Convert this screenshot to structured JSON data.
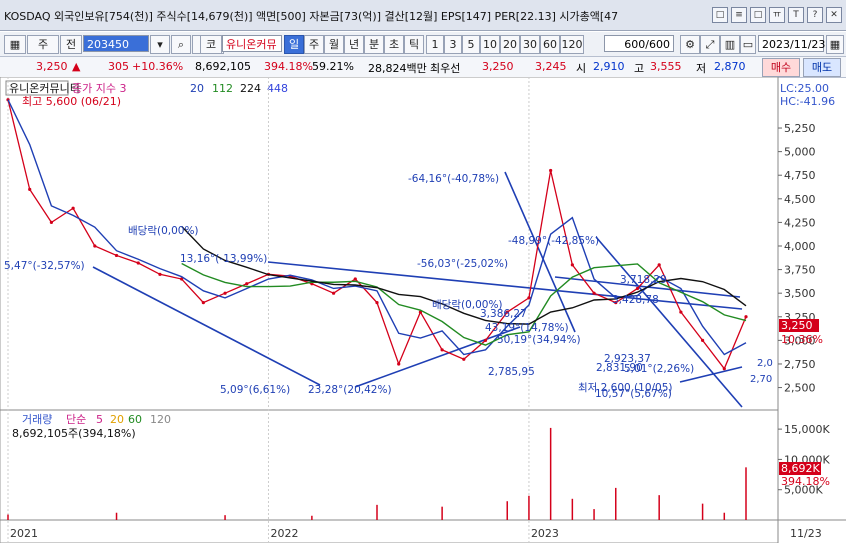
{
  "header": {
    "info": "KOSDAQ 외국인보유[754(천)] 주식수[14,679(천)] 액면[500] 자본금[73(억)] 결산[12월] EPS[147] PER[22.13] 시가총액[47",
    "icons": [
      "□",
      "≡",
      "□",
      "ㅠ",
      "T",
      "?"
    ]
  },
  "toolbar": {
    "type_select": "주",
    "prev_button": "전",
    "code": "203450",
    "kind_button": "코",
    "stock_name": "유니온커뮤",
    "periods": [
      "일",
      "주",
      "월",
      "년",
      "분",
      "초",
      "틱"
    ],
    "selected_period": "일",
    "intervals": [
      "1",
      "3",
      "5",
      "10",
      "20",
      "30",
      "60",
      "120"
    ],
    "range": "600/600",
    "date": "2023/11/23"
  },
  "quote": {
    "price": "3,250",
    "change": "305",
    "change_pct": "+10.36%",
    "volume": "8,692,105",
    "vol_ratio": "394.18%",
    "turnover": "59.21%",
    "amount": "28,824백만",
    "bid_label": "최우선",
    "bid1": "3,250",
    "bid2": "3,245",
    "open_label": "시",
    "open": "2,910",
    "high_label": "고",
    "high": "3,555",
    "low_label": "저",
    "low": "2,870",
    "buy_label": "매수",
    "sell_label": "매도"
  },
  "chart_data": {
    "type": "line",
    "title": "유니온커뮤니티",
    "legend": [
      "종가 지수 3",
      "20",
      "112",
      "224",
      "448"
    ],
    "series_colors": {
      "price": "#d4001a",
      "ma20": "#1f3fb4",
      "ma112": "#228b22",
      "ma224": "#111111",
      "ma448": "#3344dd"
    },
    "max_label": "최고 5,600 (06/21)",
    "min_label": "최저 2,600 (10/05)",
    "lc": "LC:25.00",
    "hc": "HC:-41.96",
    "price_labels": [
      "3,250",
      "10.36%"
    ],
    "right_labels": [
      "2,0",
      "2,70"
    ],
    "yaxis_ticks": [
      "5,250",
      "5,000",
      "4,750",
      "4,500",
      "4,250",
      "4,000",
      "3,750",
      "3,500",
      "3,250",
      "3,000",
      "2,750",
      "2,500"
    ],
    "ylim": [
      2400,
      5600
    ],
    "xaxis_ticks": [
      "2021",
      "2022",
      "2023",
      "11/23"
    ],
    "annotations": [
      "5,47°(-32,57%)",
      "배당락(0,00%)",
      "13,16°(-13,99%)",
      "-64,16°(-40,78%)",
      "-48,99°(-42,85%)",
      "-56,03°(-25,02%)",
      "3,718,29",
      "배당락(0,00%)",
      "3,386,27",
      "3,428,78",
      "43,19°(14,78%)",
      "50,19°(34,94%)",
      "2,923,37",
      "2,831,90",
      "5,01°(2,26%)",
      "2,785,95",
      "5,09°(6,61%)",
      "23,28°(20,42%)",
      "10,57°(5,67%)"
    ],
    "price": [
      [
        "2021-01",
        5550
      ],
      [
        "2021-02",
        4600
      ],
      [
        "2021-03",
        4250
      ],
      [
        "2021-04",
        4400
      ],
      [
        "2021-05",
        4000
      ],
      [
        "2021-06",
        3900
      ],
      [
        "2021-07",
        3820
      ],
      [
        "2021-08",
        3700
      ],
      [
        "2021-09",
        3650
      ],
      [
        "2021-10",
        3400
      ],
      [
        "2021-11",
        3500
      ],
      [
        "2021-12",
        3600
      ],
      [
        "2022-01",
        3700
      ],
      [
        "2022-02",
        3680
      ],
      [
        "2022-03",
        3600
      ],
      [
        "2022-04",
        3500
      ],
      [
        "2022-05",
        3650
      ],
      [
        "2022-06",
        3400
      ],
      [
        "2022-07",
        2750
      ],
      [
        "2022-08",
        3300
      ],
      [
        "2022-09",
        2900
      ],
      [
        "2022-10",
        2800
      ],
      [
        "2022-11",
        3000
      ],
      [
        "2022-12",
        3300
      ],
      [
        "2023-01",
        3450
      ],
      [
        "2023-02",
        4800
      ],
      [
        "2023-03",
        3800
      ],
      [
        "2023-04",
        3500
      ],
      [
        "2023-05",
        3400
      ],
      [
        "2023-06",
        3550
      ],
      [
        "2023-07",
        3800
      ],
      [
        "2023-08",
        3300
      ],
      [
        "2023-09",
        3000
      ],
      [
        "2023-10",
        2700
      ],
      [
        "2023-11",
        3250
      ]
    ],
    "volume_panel": {
      "legend": [
        "거래량",
        "단순",
        "5",
        "20",
        "60",
        "120"
      ],
      "latest": "8,692,105주(394,18%)",
      "ticks": [
        "15,000K",
        "10,000K",
        "5,000K"
      ],
      "ylim": [
        0,
        17000
      ],
      "last_value_label": "8,692K",
      "last_ratio_label": "394.18%",
      "spikes": [
        [
          "2021-01",
          900
        ],
        [
          "2021-06",
          1200
        ],
        [
          "2021-11",
          800
        ],
        [
          "2022-03",
          700
        ],
        [
          "2022-06",
          2500
        ],
        [
          "2022-09",
          2200
        ],
        [
          "2022-12",
          3100
        ],
        [
          "2023-01",
          4000
        ],
        [
          "2023-02",
          15200
        ],
        [
          "2023-03",
          3500
        ],
        [
          "2023-04",
          1800
        ],
        [
          "2023-05",
          5300
        ],
        [
          "2023-07",
          4100
        ],
        [
          "2023-09",
          2700
        ],
        [
          "2023-10",
          1200
        ],
        [
          "2023-11",
          8692
        ]
      ]
    }
  }
}
